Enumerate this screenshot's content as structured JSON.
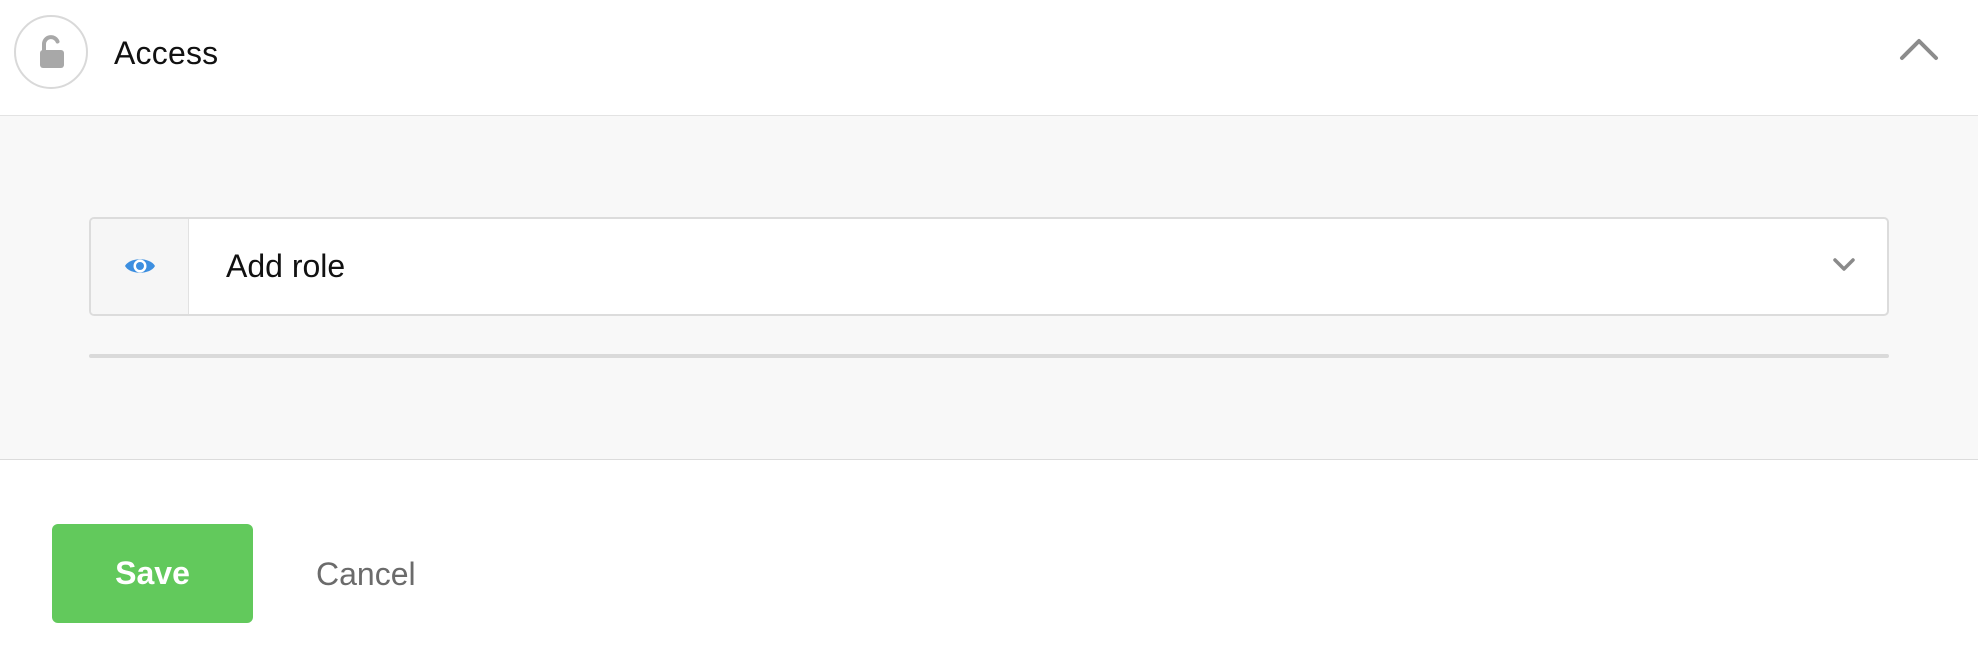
{
  "section": {
    "title": "Access",
    "lock_icon": "unlock-icon",
    "collapse_icon": "chevron-up-icon"
  },
  "role_select": {
    "value": "Add role",
    "eye_icon": "eye-icon",
    "dropdown_icon": "chevron-down-icon"
  },
  "actions": {
    "save_label": "Save",
    "cancel_label": "Cancel"
  },
  "colors": {
    "save_green": "#62c95c",
    "eye_blue": "#3d8fe0",
    "panel_bg": "#f8f8f8"
  }
}
